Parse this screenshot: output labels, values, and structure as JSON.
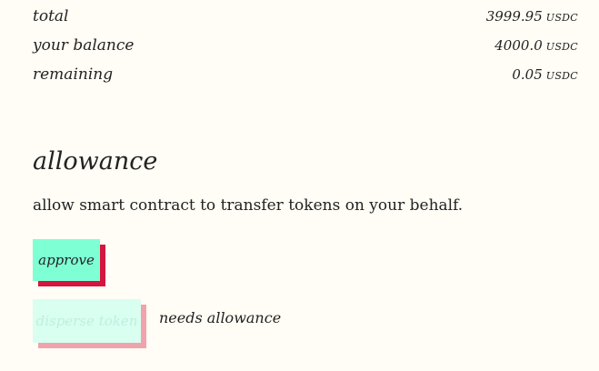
{
  "summary": {
    "rows": [
      {
        "label": "total",
        "value": "3999.95",
        "unit": "USDC"
      },
      {
        "label": "your balance",
        "value": "4000.0",
        "unit": "USDC"
      },
      {
        "label": "remaining",
        "value": "0.05",
        "unit": "USDC"
      }
    ]
  },
  "allowance": {
    "title": "allowance",
    "description": "allow smart contract to transfer tokens on your behalf.",
    "approve_label": "approve",
    "disperse_label": "disperse token",
    "disperse_hint": "needs allowance"
  },
  "colors": {
    "background": "#fffdf5",
    "approve_button": "#7fffd4",
    "approve_shadow": "#d4163e",
    "disabled_button": "#d8fff0",
    "disabled_shadow": "#f0a3ad"
  }
}
